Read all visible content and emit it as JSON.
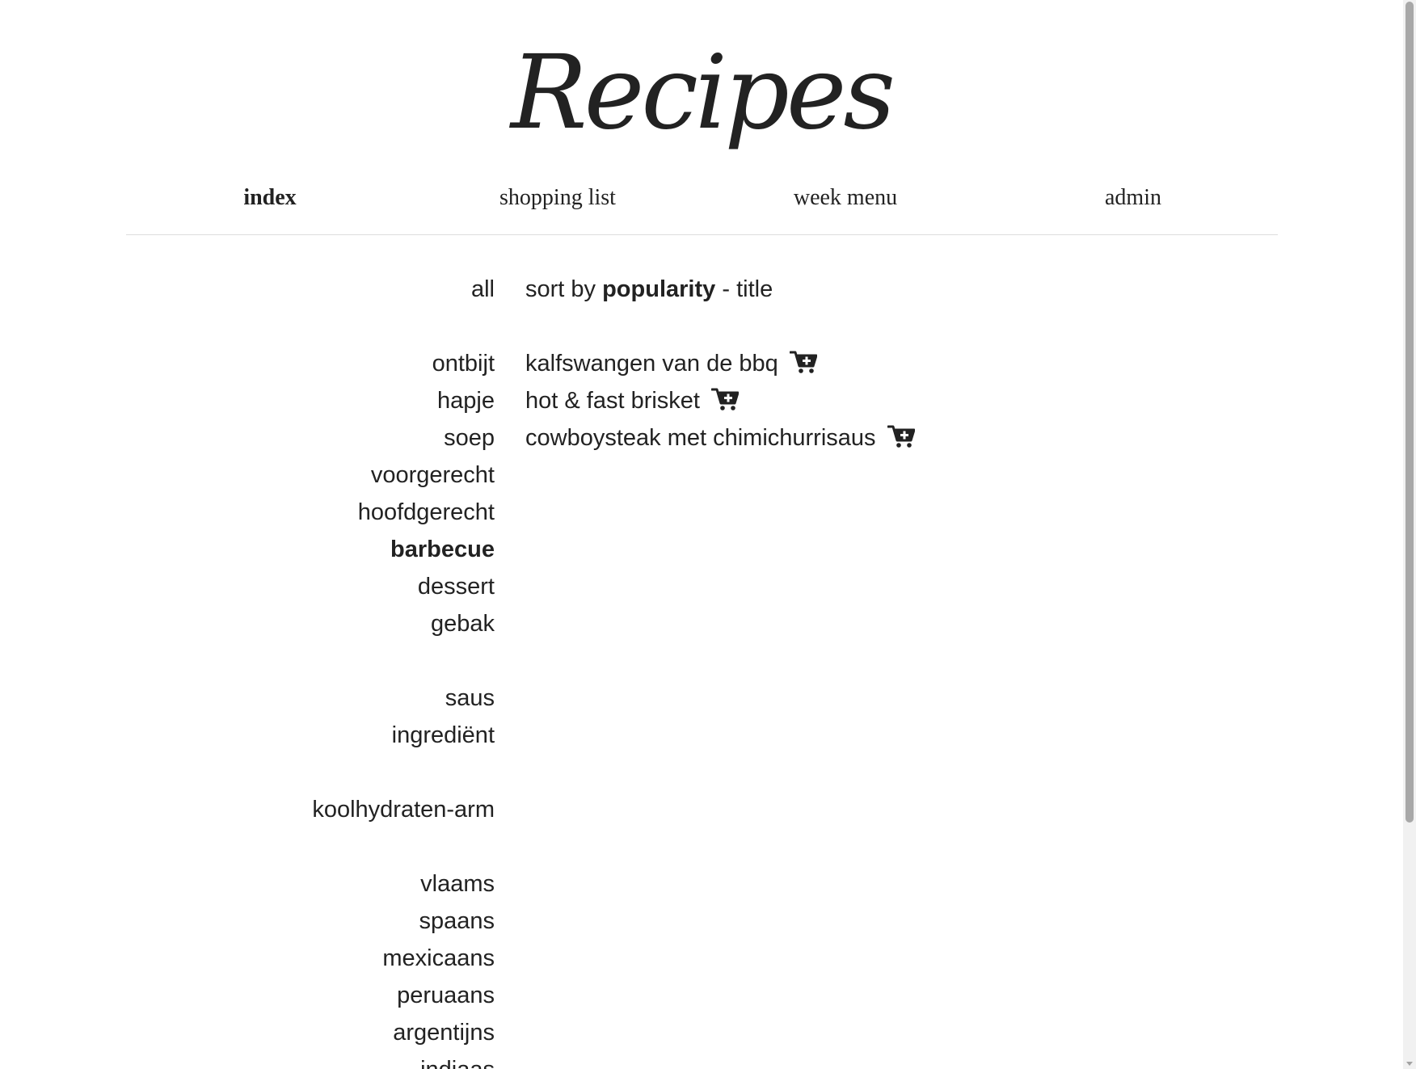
{
  "header": {
    "logo_text": "Recipes"
  },
  "nav": {
    "items": [
      {
        "label": "index",
        "active": true
      },
      {
        "label": "shopping list",
        "active": false
      },
      {
        "label": "week menu",
        "active": false
      },
      {
        "label": "admin",
        "active": false
      }
    ]
  },
  "categories": {
    "all": "all",
    "course": [
      "ontbijt",
      "hapje",
      "soep",
      "voorgerecht",
      "hoofdgerecht",
      "barbecue",
      "dessert",
      "gebak"
    ],
    "other": [
      "saus",
      "ingrediënt"
    ],
    "diet": [
      "koolhydraten-arm"
    ],
    "cuisine": [
      "vlaams",
      "spaans",
      "mexicaans",
      "peruaans",
      "argentijns",
      "indiaas"
    ],
    "active": "barbecue"
  },
  "sort": {
    "prefix": "sort by",
    "popularity": "popularity",
    "separator": "-",
    "title": "title",
    "active": "popularity"
  },
  "recipes": [
    {
      "title": "kalfswangen van de bbq",
      "icon": "cart-plus-icon"
    },
    {
      "title": "hot & fast brisket",
      "icon": "cart-plus-icon"
    },
    {
      "title": "cowboysteak met chimichurrisaus",
      "icon": "cart-plus-icon"
    }
  ],
  "colors": {
    "text": "#222222",
    "divider": "#dddddd",
    "background": "#ffffff"
  }
}
